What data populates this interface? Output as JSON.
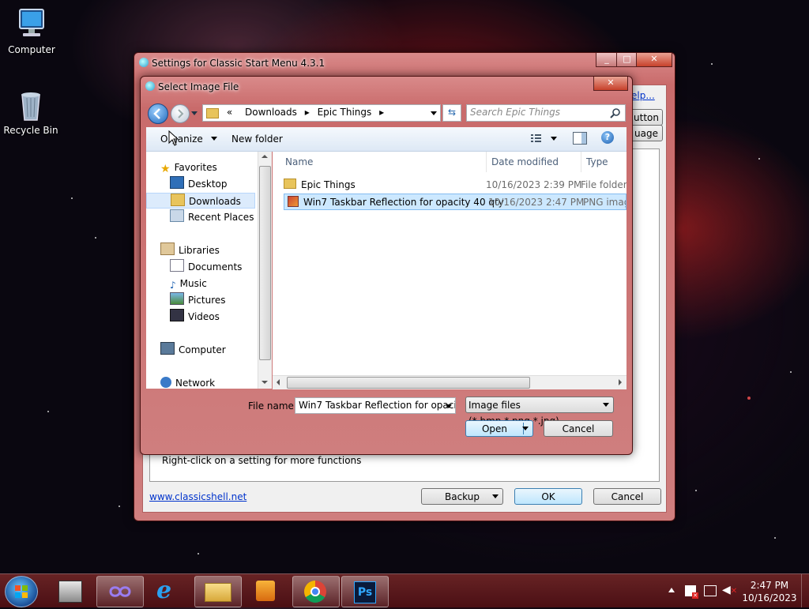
{
  "desktop": {
    "icons": [
      {
        "label": "Computer"
      },
      {
        "label": "Recycle Bin"
      }
    ]
  },
  "settings_window": {
    "title": "Settings for Classic Start Menu 4.3.1",
    "hidden_link_fragment": "elp...",
    "hidden_button_fragment": "utton",
    "hidden_tab_fragment": "uage",
    "hint": "Right-click on a setting for more functions",
    "website_link": "www.classicshell.net",
    "backup_label": "Backup",
    "ok_label": "OK",
    "cancel_label": "Cancel"
  },
  "dialog": {
    "title": "Select Image File",
    "breadcrumb": [
      "«",
      "Downloads",
      "Epic Things"
    ],
    "search_placeholder": "Search Epic Things",
    "organize_label": "Organize",
    "new_folder_label": "New folder",
    "nav": {
      "favorites": "Favorites",
      "desktop": "Desktop",
      "downloads": "Downloads",
      "recent": "Recent Places",
      "libraries": "Libraries",
      "documents": "Documents",
      "music": "Music",
      "pictures": "Pictures",
      "videos": "Videos",
      "computer": "Computer",
      "network": "Network"
    },
    "columns": {
      "name": "Name",
      "date": "Date modified",
      "type": "Type"
    },
    "files": [
      {
        "name": "Epic Things",
        "date": "10/16/2023 2:39 PM",
        "type": "File folder"
      },
      {
        "name": "Win7 Taskbar Reflection for opacity 40 qty",
        "date": "10/16/2023 2:47 PM",
        "type": "PNG imag"
      }
    ],
    "filename_label": "File name:",
    "filename_value": "Win7 Taskbar Reflection for opacit",
    "filter_value": "Image files (*.bmp,*.png,*.jpg)",
    "open_label": "Open",
    "cancel_label": "Cancel"
  },
  "taskbar": {
    "time": "2:47 PM",
    "date": "10/16/2023"
  }
}
